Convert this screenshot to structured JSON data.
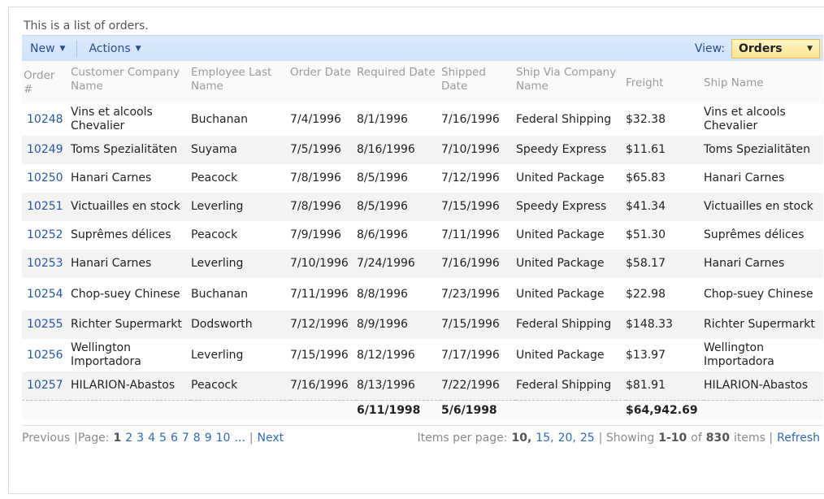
{
  "description": "This is a list of orders.",
  "toolbar": {
    "new_label": "New",
    "actions_label": "Actions",
    "view_label": "View:",
    "view_value": "Orders"
  },
  "columns": [
    "Order #",
    "Customer Company Name",
    "Employee Last Name",
    "Order Date",
    "Required Date",
    "Shipped Date",
    "Ship Via Company Name",
    "Freight",
    "Ship Name"
  ],
  "rows": [
    {
      "order": "10248",
      "customer": "Vins et alcools Chevalier",
      "employee": "Buchanan",
      "order_date": "7/4/1996",
      "required": "8/1/1996",
      "shipped": "7/16/1996",
      "ship_via": "Federal Shipping",
      "freight": "$32.38",
      "ship_name": "Vins et alcools Chevalier"
    },
    {
      "order": "10249",
      "customer": "Toms Spezialitäten",
      "employee": "Suyama",
      "order_date": "7/5/1996",
      "required": "8/16/1996",
      "shipped": "7/10/1996",
      "ship_via": "Speedy Express",
      "freight": "$11.61",
      "ship_name": "Toms Spezialitäten"
    },
    {
      "order": "10250",
      "customer": "Hanari Carnes",
      "employee": "Peacock",
      "order_date": "7/8/1996",
      "required": "8/5/1996",
      "shipped": "7/12/1996",
      "ship_via": "United Package",
      "freight": "$65.83",
      "ship_name": "Hanari Carnes"
    },
    {
      "order": "10251",
      "customer": "Victuailles en stock",
      "employee": "Leverling",
      "order_date": "7/8/1996",
      "required": "8/5/1996",
      "shipped": "7/15/1996",
      "ship_via": "Speedy Express",
      "freight": "$41.34",
      "ship_name": "Victuailles en stock"
    },
    {
      "order": "10252",
      "customer": "Suprêmes délices",
      "employee": "Peacock",
      "order_date": "7/9/1996",
      "required": "8/6/1996",
      "shipped": "7/11/1996",
      "ship_via": "United Package",
      "freight": "$51.30",
      "ship_name": "Suprêmes délices"
    },
    {
      "order": "10253",
      "customer": "Hanari Carnes",
      "employee": "Leverling",
      "order_date": "7/10/1996",
      "required": "7/24/1996",
      "shipped": "7/16/1996",
      "ship_via": "United Package",
      "freight": "$58.17",
      "ship_name": "Hanari Carnes"
    },
    {
      "order": "10254",
      "customer": "Chop-suey Chinese",
      "employee": "Buchanan",
      "order_date": "7/11/1996",
      "required": "8/8/1996",
      "shipped": "7/23/1996",
      "ship_via": "United Package",
      "freight": "$22.98",
      "ship_name": "Chop-suey Chinese"
    },
    {
      "order": "10255",
      "customer": "Richter Supermarkt",
      "employee": "Dodsworth",
      "order_date": "7/12/1996",
      "required": "8/9/1996",
      "shipped": "7/15/1996",
      "ship_via": "Federal Shipping",
      "freight": "$148.33",
      "ship_name": "Richter Supermarkt"
    },
    {
      "order": "10256",
      "customer": "Wellington Importadora",
      "employee": "Leverling",
      "order_date": "7/15/1996",
      "required": "8/12/1996",
      "shipped": "7/17/1996",
      "ship_via": "United Package",
      "freight": "$13.97",
      "ship_name": "Wellington Importadora"
    },
    {
      "order": "10257",
      "customer": "HILARION-Abastos",
      "employee": "Peacock",
      "order_date": "7/16/1996",
      "required": "8/13/1996",
      "shipped": "7/22/1996",
      "ship_via": "Federal Shipping",
      "freight": "$81.91",
      "ship_name": "HILARION-Abastos"
    }
  ],
  "totals": {
    "required": "6/11/1998",
    "shipped": "5/6/1998",
    "freight": "$64,942.69"
  },
  "pager": {
    "previous": "Previous",
    "page_label": "|Page:",
    "current_page": "1",
    "pages": [
      "2",
      "3",
      "4",
      "5",
      "6",
      "7",
      "8",
      "9",
      "10"
    ],
    "ellipsis": "...",
    "sep": "|",
    "next": "Next",
    "items_per_page_label": "Items per page:",
    "per_page_current": "10,",
    "per_page_options": [
      "15,",
      "20,",
      "25"
    ],
    "showing_prefix": "| Showing",
    "showing_range": "1-10",
    "of": "of",
    "total": "830",
    "items": "items |",
    "refresh": "Refresh"
  }
}
